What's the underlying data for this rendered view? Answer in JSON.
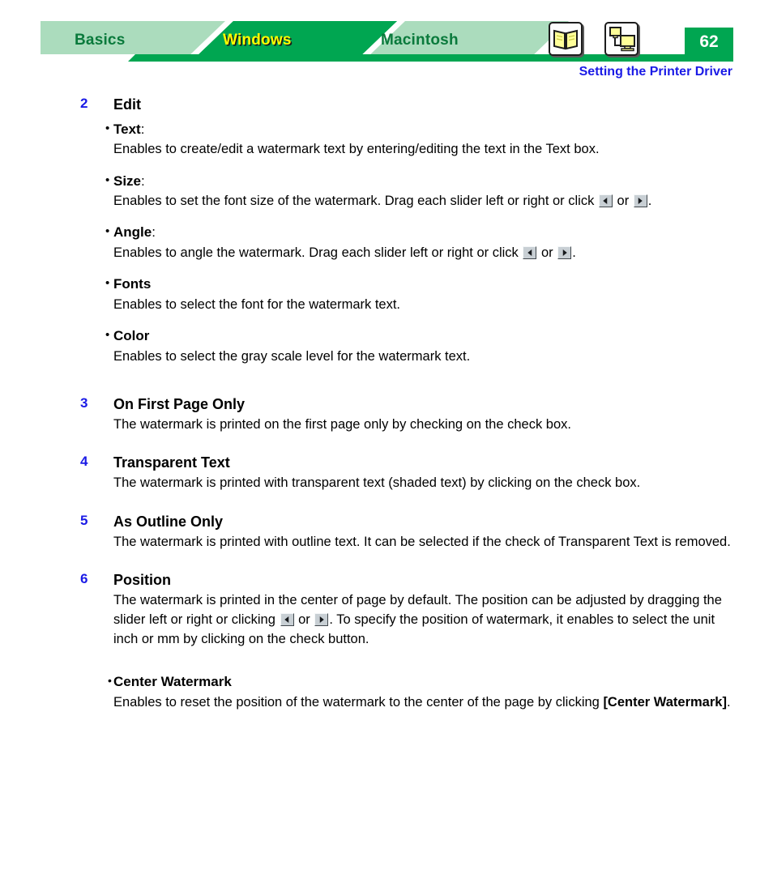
{
  "header": {
    "tabs": [
      {
        "label": "Basics",
        "state": "inactive",
        "icon": "tab-basics"
      },
      {
        "label": "Windows",
        "state": "active",
        "icon": "tab-windows"
      },
      {
        "label": "Macintosh",
        "state": "inactive",
        "icon": "tab-macintosh"
      }
    ],
    "icons": [
      {
        "name": "open-book-icon",
        "title": "Table of contents"
      },
      {
        "name": "network-computers-icon",
        "title": "Network"
      }
    ],
    "page_number": "62",
    "subtitle": "Setting the Printer Driver",
    "colors": {
      "tab_active_bg": "#00a651",
      "tab_inactive_bg": "#abdcbd",
      "tab_inactive_text": "#0a7a3c",
      "tab_active_text": "#ffff00",
      "page_badge_bg": "#00a651",
      "subtitle_text": "#1a1ae6",
      "section_number": "#1a1ae6",
      "icon_fill": "#ffff99"
    }
  },
  "content": {
    "sections": [
      {
        "number": "2",
        "title": "Edit",
        "sub_items": [
          {
            "bullet": "•",
            "head": "Text",
            "head_suffix": ":",
            "body_before": "Enables to create/edit a watermark text by entering/editing the text in the Text box.",
            "body_mid": "",
            "body_after": ""
          },
          {
            "bullet": "•",
            "head": "Size",
            "head_suffix": ":",
            "body_before": "Enables to set the font size of the watermark. Drag each slider left or right or click ",
            "body_mid": " or ",
            "body_after": "."
          },
          {
            "bullet": "•",
            "head": "Angle",
            "head_suffix": ":",
            "body_before": "Enables to angle the watermark. Drag each slider left or right or click ",
            "body_mid": " or ",
            "body_after": "."
          },
          {
            "bullet": "•",
            "head": "Fonts",
            "head_suffix": "",
            "body_before": "Enables to select the font for the watermark text.",
            "body_mid": "",
            "body_after": ""
          },
          {
            "bullet": "•",
            "head": "Color",
            "head_suffix": "",
            "body_before": "Enables to select the gray scale level for the watermark text.",
            "body_mid": "",
            "body_after": ""
          }
        ]
      },
      {
        "number": "3",
        "title": "On First Page Only",
        "body": "The watermark is printed on the first page only by checking on the check box."
      },
      {
        "number": "4",
        "title": "Transparent Text",
        "body": "The watermark is printed with transparent text (shaded text) by clicking on the check box."
      },
      {
        "number": "5",
        "title": "As Outline Only",
        "body": "The watermark is printed with outline text. It can be selected if the check of Transparent Text is removed."
      },
      {
        "number": "6",
        "title": "Position",
        "body_before": "The watermark is printed in the center of page by default. The position can be adjusted by dragging the slider left or right or clicking ",
        "body_mid": " or ",
        "body_after": ". To specify the position of watermark, it enables to select the unit inch or mm by clicking on the check button.",
        "center_watermark": {
          "bullet": "•",
          "head": "Center Watermark",
          "body_before": "Enables to reset the position of the watermark to the center of the page by clicking ",
          "body_bold": "[Center Watermark]",
          "body_after": "."
        }
      }
    ]
  },
  "controls": {
    "spinner_left": "left-arrow-spinner",
    "spinner_right": "right-arrow-spinner"
  }
}
